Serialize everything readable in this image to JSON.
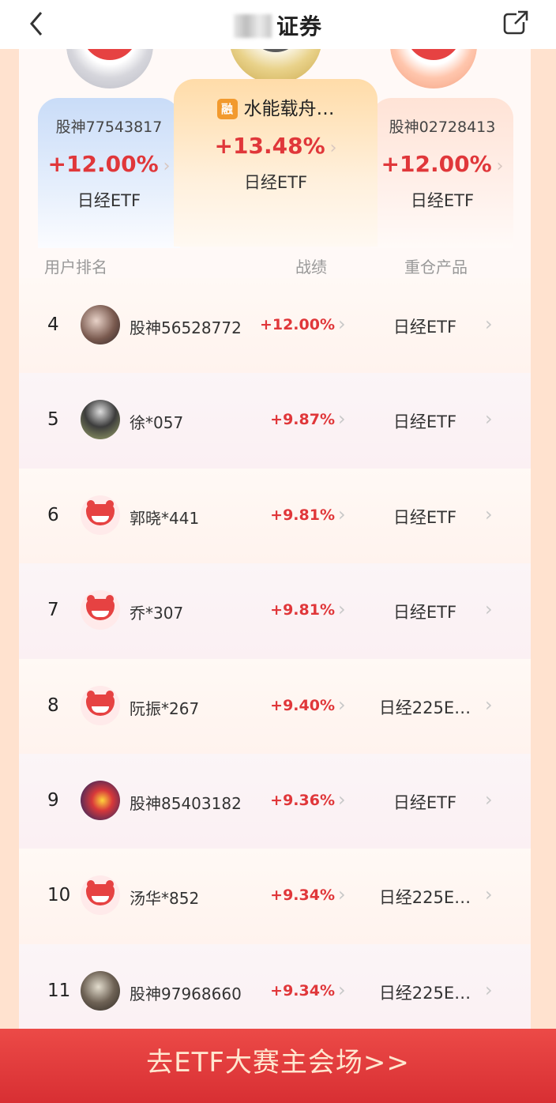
{
  "nav": {
    "title": "证券",
    "back_icon": "chevron-left-icon",
    "share_icon": "external-link-icon"
  },
  "podium": {
    "first": {
      "name": "水能载舟…",
      "badge": "融",
      "pct": "+13.48%",
      "product": "日经ETF"
    },
    "second": {
      "name": "股神77543817",
      "pct": "+12.00%",
      "product": "日经ETF"
    },
    "third": {
      "name": "股神02728413",
      "pct": "+12.00%",
      "product": "日经ETF"
    }
  },
  "columns": {
    "rank": "用户排名",
    "performance": "战绩",
    "product": "重仓产品"
  },
  "rows": [
    {
      "rank": "4",
      "name": "股神56528772",
      "pct": "+12.00%",
      "product": "日经ETF",
      "avatar": "photo1"
    },
    {
      "rank": "5",
      "name": "徐*057",
      "pct": "+9.87%",
      "product": "日经ETF",
      "avatar": "photo2"
    },
    {
      "rank": "6",
      "name": "郭晓*441",
      "pct": "+9.81%",
      "product": "日经ETF",
      "avatar": "mascot"
    },
    {
      "rank": "7",
      "name": "乔*307",
      "pct": "+9.81%",
      "product": "日经ETF",
      "avatar": "mascot"
    },
    {
      "rank": "8",
      "name": "阮振*267",
      "pct": "+9.40%",
      "product": "日经225E…",
      "avatar": "mascot"
    },
    {
      "rank": "9",
      "name": "股神85403182",
      "pct": "+9.36%",
      "product": "日经ETF",
      "avatar": "photo3"
    },
    {
      "rank": "10",
      "name": "汤华*852",
      "pct": "+9.34%",
      "product": "日经225E…",
      "avatar": "mascot"
    },
    {
      "rank": "11",
      "name": "股神97968660",
      "pct": "+9.34%",
      "product": "日经225E…",
      "avatar": "photo4"
    }
  ],
  "banner": {
    "label": "去ETF大赛主会场>>"
  },
  "colors": {
    "accent_red": "#e0373a",
    "banner_red": "#d82f33",
    "frame_orange": "#ffe2cf"
  }
}
